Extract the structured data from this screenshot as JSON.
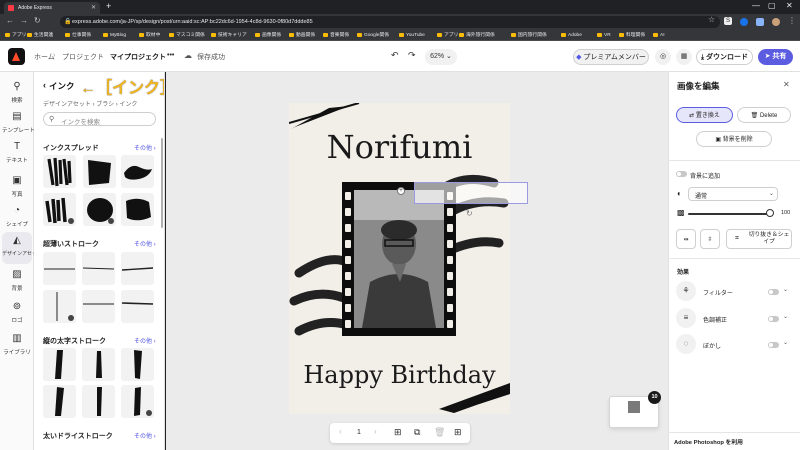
{
  "browser": {
    "tab_title": "Adobe Express",
    "url": "express.adobe.com/ja-JP/sp/design/post/urn:aaid:sc:AP:bc22dc6d-1954-4c8d-9630-0f80d7ddde85",
    "bookmarks": [
      "アプリ",
      "生活関連",
      "仕事関係",
      "MyBlog",
      "取材中",
      "マスコミ関係",
      "技術キャリア",
      "画像関係",
      "動画関係",
      "音楽関係",
      "Google関係",
      "YouTube",
      "アプリ",
      "海外旅行関係",
      "国内旅行関係",
      "Adobe",
      "VR",
      "料理関係",
      "AI"
    ]
  },
  "header": {
    "home": "ホーム",
    "project": "プロジェクト",
    "my_project": "マイプロジェクト",
    "more": "•••",
    "save_status": "保存成功",
    "zoom": "62%",
    "premium": "プレミアムメンバー",
    "download": "ダウンロード",
    "share": "共有"
  },
  "rail": [
    {
      "icon": "search-icon",
      "glyph": "⚲",
      "label": "検索"
    },
    {
      "icon": "template-icon",
      "glyph": "▤",
      "label": "テンプレート"
    },
    {
      "icon": "text-icon",
      "glyph": "T",
      "label": "テキスト"
    },
    {
      "icon": "photo-icon",
      "glyph": "▣",
      "label": "写真"
    },
    {
      "icon": "shape-icon",
      "glyph": "◔",
      "label": "シェイプ"
    },
    {
      "icon": "design-asset-icon",
      "glyph": "◭",
      "label": "デザインアセット"
    },
    {
      "icon": "background-icon",
      "glyph": "▨",
      "label": "背景"
    },
    {
      "icon": "logo-icon",
      "glyph": "⊚",
      "label": "ロゴ"
    },
    {
      "icon": "library-icon",
      "glyph": "▥",
      "label": "ライブラリ"
    }
  ],
  "panel": {
    "back_title": "インク",
    "annotation": "←［インク］",
    "breadcrumb": "デザインアセット › ブラシ › インク",
    "search_placeholder": "インクを検索",
    "sections": [
      {
        "title": "インクスプレッド",
        "more": "その他 ›"
      },
      {
        "title": "超薄いストローク",
        "more": "その他 ›"
      },
      {
        "title": "縦の太字ストローク",
        "more": "その他 ›"
      },
      {
        "title": "太いドライストローク",
        "more": "その他 ›"
      }
    ]
  },
  "canvas": {
    "title": "Norifumi",
    "greeting": "Happy Birthday",
    "page_number": "1",
    "notif_count": "10"
  },
  "right_panel": {
    "title": "画像を編集",
    "replace": "置き換え",
    "delete": "Delete",
    "remove_bg": "背景を削除",
    "add_bg": "背景に追加",
    "blend_mode": "通常",
    "opacity": "100",
    "crop": "切り抜き＆シェイプ",
    "effects": "効果",
    "filter": "フィルター",
    "adjust": "色調補正",
    "blur": "ぼかし",
    "photoshop": "Adobe Photoshop を利用"
  }
}
